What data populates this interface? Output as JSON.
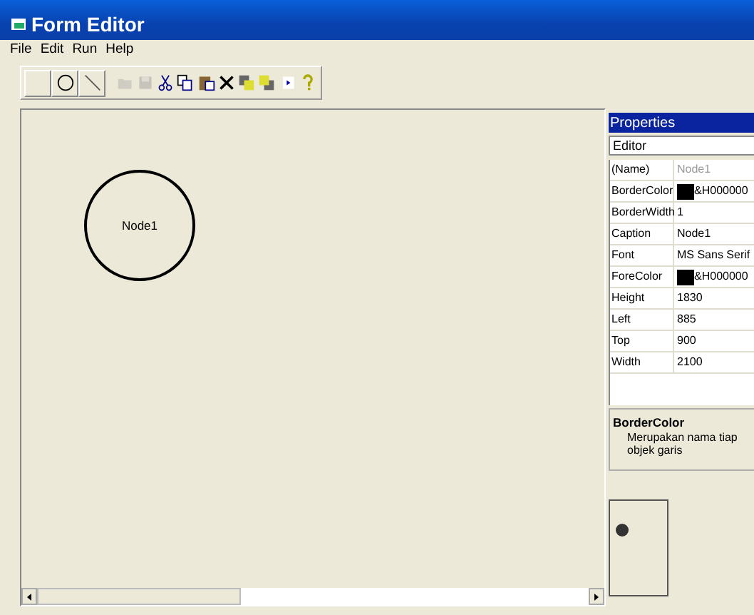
{
  "window": {
    "title": "Form Editor"
  },
  "menu": [
    "File",
    "Edit",
    "Run",
    "Help"
  ],
  "toolbar": [
    {
      "kind": "blank"
    },
    {
      "kind": "circle"
    },
    {
      "kind": "line"
    },
    {
      "kind": "open",
      "disabled": true
    },
    {
      "kind": "save",
      "disabled": true
    },
    {
      "kind": "cut",
      "disabled": false
    },
    {
      "kind": "copy",
      "disabled": false
    },
    {
      "kind": "paste",
      "disabled": false
    },
    {
      "kind": "delete",
      "disabled": false
    },
    {
      "kind": "front",
      "disabled": false
    },
    {
      "kind": "back",
      "disabled": false
    },
    {
      "kind": "run",
      "disabled": false
    },
    {
      "kind": "help",
      "disabled": false
    }
  ],
  "canvas": {
    "nodes": [
      {
        "caption": "Node1"
      }
    ]
  },
  "properties": {
    "title": "Properties",
    "object": "Editor",
    "rows": [
      {
        "name": "(Name)",
        "value": "Node1",
        "disabled": true
      },
      {
        "name": "BorderColor",
        "value": "&H000000",
        "disabled": false,
        "color": "#000000"
      },
      {
        "name": "BorderWidth",
        "value": "1",
        "disabled": false
      },
      {
        "name": "Caption",
        "value": "Node1",
        "disabled": false
      },
      {
        "name": "Font",
        "value": "MS Sans Serif",
        "disabled": false
      },
      {
        "name": "ForeColor",
        "value": "&H000000",
        "disabled": false,
        "color": "#000000"
      },
      {
        "name": "Height",
        "value": "1830",
        "disabled": false
      },
      {
        "name": "Left",
        "value": "885",
        "disabled": false
      },
      {
        "name": "Top",
        "value": "900",
        "disabled": false
      },
      {
        "name": "Width",
        "value": "2100",
        "disabled": false
      }
    ],
    "description": {
      "title": "BorderColor",
      "text": "Merupakan nama tiap objek garis"
    }
  }
}
